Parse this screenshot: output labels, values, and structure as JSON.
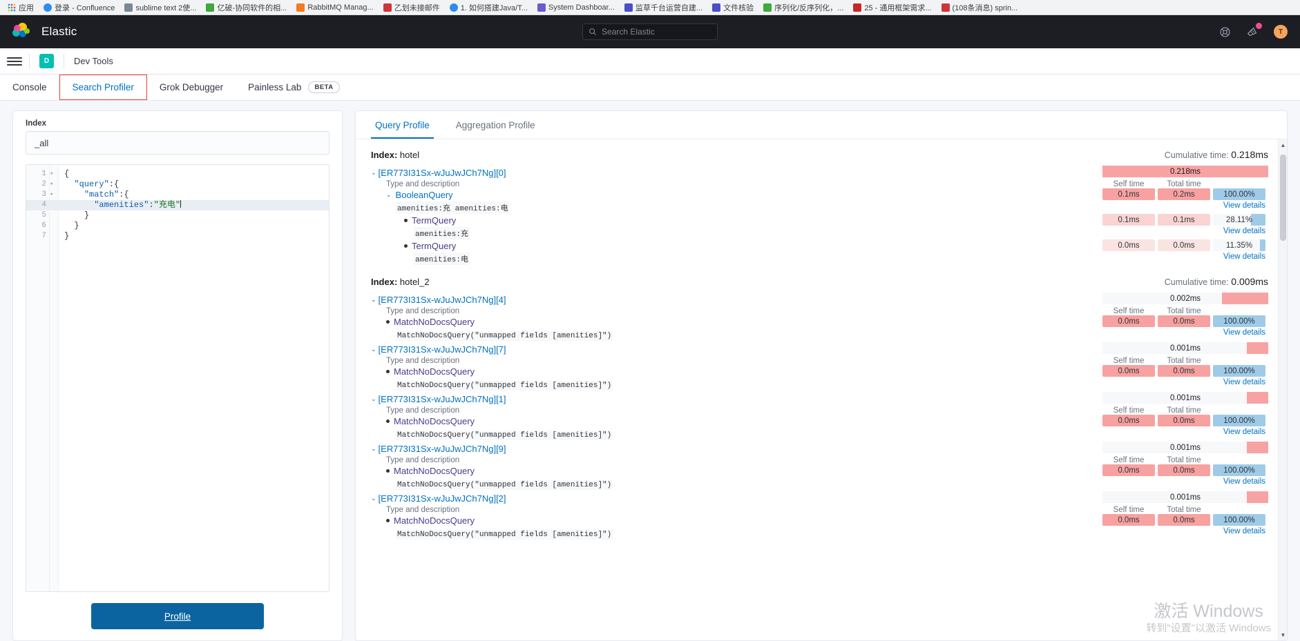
{
  "browser": {
    "bookmarks": [
      {
        "label": "应用",
        "icon": "apps-grid-icon",
        "color": "apps"
      },
      {
        "label": "登录 - Confluence",
        "icon": "confluence-icon",
        "color": "blue"
      },
      {
        "label": "sublime text 2使...",
        "icon": "search-icon",
        "color": "gray"
      },
      {
        "label": "亿破-协同软件的相...",
        "icon": "leaf-icon",
        "color": "green"
      },
      {
        "label": "RabbitMQ Manag...",
        "icon": "rabbitmq-icon",
        "color": "orange"
      },
      {
        "label": "乙划未接邮件",
        "icon": "mail-icon",
        "color": "red"
      },
      {
        "label": "1. 如何搭建Java/T...",
        "icon": "globe-icon",
        "color": "blue"
      },
      {
        "label": "System Dashboar...",
        "icon": "jira-icon",
        "color": "violet"
      },
      {
        "label": "监草千台运营自建...",
        "icon": "doc-icon",
        "color": "purple"
      },
      {
        "label": "文件核验",
        "icon": "doc-icon",
        "color": "purple"
      },
      {
        "label": "序列化/反序列化，...",
        "icon": "leaf-icon",
        "color": "green"
      },
      {
        "label": "25 - 通用框架需求...",
        "icon": "sheet-icon",
        "color": "darkred"
      },
      {
        "label": "(108条消息) sprin...",
        "icon": "csdn-icon",
        "color": "red"
      }
    ]
  },
  "header": {
    "product": "Elastic",
    "logo_icon": "elastic-logo-icon",
    "search_placeholder": "Search Elastic",
    "search_icon": "search-icon",
    "help_icon": "help-lifebuoy-icon",
    "news_icon": "news-megaphone-icon",
    "avatar_initial": "T",
    "badge": ""
  },
  "breadcrumb": {
    "menu_icon": "hamburger-menu-icon",
    "space_initial": "D",
    "app_name": "Dev Tools"
  },
  "devtools_tabs": [
    {
      "label": "Console",
      "active": false,
      "boxed": false,
      "badge": null
    },
    {
      "label": "Search Profiler",
      "active": true,
      "boxed": true,
      "badge": null
    },
    {
      "label": "Grok Debugger",
      "active": false,
      "boxed": false,
      "badge": null
    },
    {
      "label": "Painless Lab",
      "active": false,
      "boxed": false,
      "badge": "BETA"
    }
  ],
  "left_panel": {
    "index_label": "Index",
    "index_value": "_all",
    "index_placeholder": "_all",
    "profile_button": "Profile",
    "editor_lines": [
      {
        "num": "1",
        "fold": "▾",
        "indent": 0,
        "parts": [
          {
            "t": "{",
            "c": "punc"
          }
        ],
        "highlight": false
      },
      {
        "num": "2",
        "fold": "▾",
        "indent": 1,
        "parts": [
          {
            "t": "\"query\"",
            "c": "key"
          },
          {
            "t": ":{",
            "c": "punc"
          }
        ],
        "highlight": false
      },
      {
        "num": "3",
        "fold": "▾",
        "indent": 2,
        "parts": [
          {
            "t": "\"match\"",
            "c": "key"
          },
          {
            "t": ":{",
            "c": "punc"
          }
        ],
        "highlight": false
      },
      {
        "num": "4",
        "fold": "",
        "indent": 3,
        "parts": [
          {
            "t": "\"amenities\"",
            "c": "key"
          },
          {
            "t": ":",
            "c": "punc"
          },
          {
            "t": "\"充电\"",
            "c": "str"
          }
        ],
        "highlight": true
      },
      {
        "num": "5",
        "fold": "",
        "indent": 2,
        "parts": [
          {
            "t": "}",
            "c": "punc"
          }
        ],
        "highlight": false
      },
      {
        "num": "6",
        "fold": "",
        "indent": 1,
        "parts": [
          {
            "t": "}",
            "c": "punc"
          }
        ],
        "highlight": false
      },
      {
        "num": "7",
        "fold": "",
        "indent": 0,
        "parts": [
          {
            "t": "}",
            "c": "punc"
          }
        ],
        "highlight": false
      }
    ]
  },
  "right_panel": {
    "tabs": [
      {
        "label": "Query Profile",
        "active": true
      },
      {
        "label": "Aggregation Profile",
        "active": false
      }
    ],
    "labels": {
      "index_prefix": "Index:",
      "cumulative_prefix": "Cumulative time:",
      "type_and_description": "Type and description",
      "self_time": "Self time",
      "total_time": "Total time",
      "view_details": "View details"
    },
    "indices": [
      {
        "name": "hotel",
        "cumulative_time": "0.218ms",
        "shards": [
          {
            "id": "[ER773I31Sx-wJuJwJCh7Ng][0]",
            "bar_label": "0.218ms",
            "bar_fill_pct": 100,
            "nodes": [
              {
                "level": 1,
                "type": "BooleanQuery",
                "is_link": true,
                "has_chevron": true,
                "desc": "amenities:充 amenities:电",
                "self_time": "0.1ms",
                "total_time": "0.2ms",
                "percent": "100.00%",
                "percent_fill": 100,
                "self_shade": "red-strong",
                "total_shade": "red-strong"
              },
              {
                "level": 2,
                "type": "TermQuery",
                "is_link": false,
                "has_chevron": false,
                "desc": "amenities:充",
                "self_time": "0.1ms",
                "total_time": "0.1ms",
                "percent": "28.11%",
                "percent_fill": 28,
                "self_shade": "red-mid",
                "total_shade": "red-mid"
              },
              {
                "level": 2,
                "type": "TermQuery",
                "is_link": false,
                "has_chevron": false,
                "desc": "amenities:电",
                "self_time": "0.0ms",
                "total_time": "0.0ms",
                "percent": "11.35%",
                "percent_fill": 11,
                "self_shade": "red-light",
                "total_shade": "red-light"
              }
            ]
          }
        ]
      },
      {
        "name": "hotel_2",
        "cumulative_time": "0.009ms",
        "shards": [
          {
            "id": "[ER773I31Sx-wJuJwJCh7Ng][4]",
            "bar_label": "0.002ms",
            "bar_fill_pct": 28,
            "nodes": [
              {
                "level": 1,
                "type": "MatchNoDocsQuery",
                "is_link": false,
                "has_chevron": false,
                "desc": "MatchNoDocsQuery(\"unmapped fields [amenities]\")",
                "self_time": "0.0ms",
                "total_time": "0.0ms",
                "percent": "100.00%",
                "percent_fill": 100,
                "self_shade": "red-strong",
                "total_shade": "red-strong"
              }
            ]
          },
          {
            "id": "[ER773I31Sx-wJuJwJCh7Ng][7]",
            "bar_label": "0.001ms",
            "bar_fill_pct": 13,
            "nodes": [
              {
                "level": 1,
                "type": "MatchNoDocsQuery",
                "is_link": false,
                "has_chevron": false,
                "desc": "MatchNoDocsQuery(\"unmapped fields [amenities]\")",
                "self_time": "0.0ms",
                "total_time": "0.0ms",
                "percent": "100.00%",
                "percent_fill": 100,
                "self_shade": "red-strong",
                "total_shade": "red-strong"
              }
            ]
          },
          {
            "id": "[ER773I31Sx-wJuJwJCh7Ng][1]",
            "bar_label": "0.001ms",
            "bar_fill_pct": 13,
            "nodes": [
              {
                "level": 1,
                "type": "MatchNoDocsQuery",
                "is_link": false,
                "has_chevron": false,
                "desc": "MatchNoDocsQuery(\"unmapped fields [amenities]\")",
                "self_time": "0.0ms",
                "total_time": "0.0ms",
                "percent": "100.00%",
                "percent_fill": 100,
                "self_shade": "red-strong",
                "total_shade": "red-strong"
              }
            ]
          },
          {
            "id": "[ER773I31Sx-wJuJwJCh7Ng][9]",
            "bar_label": "0.001ms",
            "bar_fill_pct": 13,
            "nodes": [
              {
                "level": 1,
                "type": "MatchNoDocsQuery",
                "is_link": false,
                "has_chevron": false,
                "desc": "MatchNoDocsQuery(\"unmapped fields [amenities]\")",
                "self_time": "0.0ms",
                "total_time": "0.0ms",
                "percent": "100.00%",
                "percent_fill": 100,
                "self_shade": "red-strong",
                "total_shade": "red-strong"
              }
            ]
          },
          {
            "id": "[ER773I31Sx-wJuJwJCh7Ng][2]",
            "bar_label": "0.001ms",
            "bar_fill_pct": 13,
            "nodes": [
              {
                "level": 1,
                "type": "MatchNoDocsQuery",
                "is_link": false,
                "has_chevron": false,
                "desc": "MatchNoDocsQuery(\"unmapped fields [amenities]\")",
                "self_time": "0.0ms",
                "total_time": "0.0ms",
                "percent": "100.00%",
                "percent_fill": 100,
                "self_shade": "red-strong",
                "total_shade": "red-strong"
              }
            ]
          }
        ]
      }
    ]
  },
  "watermark": {
    "line1": "激活 Windows",
    "line2": "转到\"设置\"以激活 Windows"
  }
}
